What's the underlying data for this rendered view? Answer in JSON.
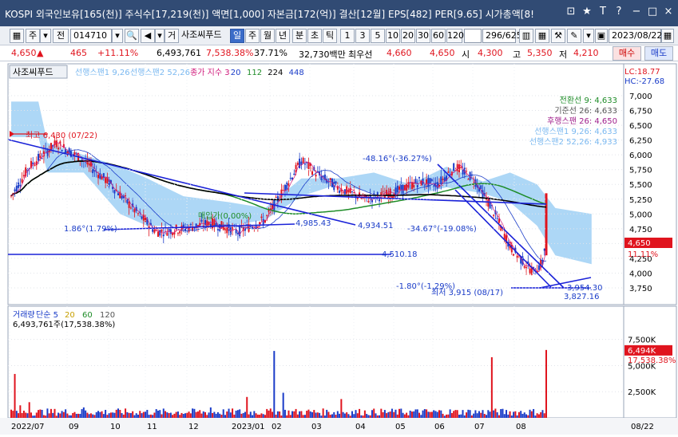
{
  "window": {
    "title": "KOSPI 외국인보유[165(천)] 주식수[17,219(천)] 액면[1,000] 자본금[172(억)] 결산[12월] EPS[482] PER[9.65] 시가총액[8!",
    "buttons": [
      "⊡",
      "★",
      "T",
      "?",
      "−",
      "□",
      "×"
    ]
  },
  "toolbar": {
    "market": "주",
    "prev": "전",
    "code": "014710",
    "name": "사조씨푸드",
    "periods": [
      "일",
      "주",
      "월",
      "년",
      "분",
      "초",
      "틱"
    ],
    "active_period": "일",
    "nums": [
      "1",
      "3",
      "5",
      "10",
      "20",
      "30",
      "60",
      "120"
    ],
    "count": "296/625",
    "date": "2023/08/22"
  },
  "quote": {
    "price": "4,650",
    "arrow": "▲",
    "change": "465",
    "rate": "+11.11%",
    "volume": "6,493,761",
    "vol_rate": "7,538.38%",
    "turnover": "37.71%",
    "amount": "32,730백만",
    "ref_label": "최우선",
    "bid1": "4,660",
    "bid2": "4,650",
    "open_label": "시",
    "open": "4,300",
    "high_label": "고",
    "high": "5,350",
    "low_label": "저",
    "low": "4,210",
    "buy": "매수",
    "sell": "매도"
  },
  "price_pane": {
    "stock": "사조씨푸드",
    "legend": [
      {
        "text": "선행스팬1 9,26",
        "color": "#7ab8f0"
      },
      {
        "text": "선행스팬2 52,26",
        "color": "#7ab8f0"
      },
      {
        "text": "종가 지수 3",
        "color": "#d0187a"
      },
      {
        "text": "20",
        "color": "#1a3cc8"
      },
      {
        "text": "112",
        "color": "#1e8c28"
      },
      {
        "text": "224",
        "color": "#000000"
      },
      {
        "text": "448",
        "color": "#1a3cc8"
      }
    ],
    "lc": "LC:18.77",
    "hc": "HC:-27.68",
    "ichimoku": [
      {
        "text": "전환선 9: 4,633",
        "color": "#1e8c28"
      },
      {
        "text": "기준선 26: 4,633",
        "color": "#555555"
      },
      {
        "text": "후행스팬 26: 4,650",
        "color": "#a0208c"
      },
      {
        "text": "선행스팬1 9,26: 4,633",
        "color": "#7ab8f0"
      },
      {
        "text": "선행스팬2 52,26: 4,933",
        "color": "#7ab8f0"
      }
    ],
    "yticks": [
      "7,000",
      "6,750",
      "6,500",
      "6,250",
      "6,000",
      "5,750",
      "5,500",
      "5,250",
      "5,000",
      "4,750",
      "4,500",
      "4,250",
      "4,000",
      "3,750"
    ],
    "price_tag": "4,650",
    "price_tag2": "11.11%",
    "annotations": {
      "high": "최고 6,430 (07/22)",
      "low": "최저 3,915 (08/17)",
      "t1": "-48.16°(-36.27%)",
      "t2": "-34.67°(-19.08%)",
      "t3": "1.86°(1.79%)",
      "t4": "-1.80°(-1.29%)",
      "t5": "매입가(0.00%)",
      "l1": "4,985.43",
      "l2": "4,934.51",
      "l3": "4,510.18",
      "l4": "3,954.30",
      "l5": "3,827.16"
    }
  },
  "volume_pane": {
    "legend": [
      {
        "text": "거래량",
        "color": "#1a3cc8"
      },
      {
        "text": "단순 5",
        "color": "#1a3cc8"
      },
      {
        "text": "20",
        "color": "#c8a000"
      },
      {
        "text": "60",
        "color": "#1e8c28"
      },
      {
        "text": "120",
        "color": "#555555"
      }
    ],
    "value": "6,493,761주(17,538.38%)",
    "yticks": [
      "7,500K",
      "5,000K",
      "2,500K"
    ],
    "vol_tag": "6,494K",
    "vol_tag2": "17,538.38%"
  },
  "xaxis": {
    "labels": [
      "2022/07",
      "09",
      "10",
      "11",
      "12",
      "2023/01",
      "02",
      "03",
      "04",
      "05",
      "06",
      "07",
      "08"
    ],
    "right": "08/22"
  }
}
